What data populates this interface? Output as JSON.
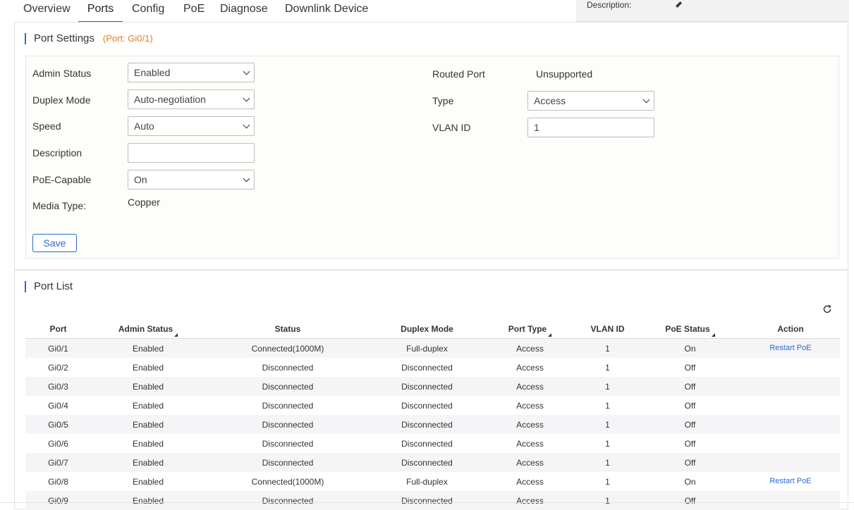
{
  "tabs": [
    {
      "label": "Overview"
    },
    {
      "label": "Ports"
    },
    {
      "label": "Config"
    },
    {
      "label": "PoE"
    },
    {
      "label": "Diagnose"
    },
    {
      "label": "Downlink Device"
    }
  ],
  "description_panel": {
    "label": "Description:",
    "edit_icon": "pencil-icon"
  },
  "port_settings": {
    "title": "Port Settings",
    "port_tag": "(Port: Gi0/1)",
    "admin_status": {
      "label": "Admin Status",
      "value": "Enabled"
    },
    "duplex_mode": {
      "label": "Duplex Mode",
      "value": "Auto-negotiation"
    },
    "speed": {
      "label": "Speed",
      "value": "Auto"
    },
    "description": {
      "label": "Description",
      "value": ""
    },
    "poe_capable": {
      "label": "PoE-Capable",
      "value": "On"
    },
    "media_type": {
      "label": "Media Type:",
      "value": "Copper"
    },
    "routed_port": {
      "label": "Routed Port",
      "value": "Unsupported"
    },
    "type": {
      "label": "Type",
      "value": "Access"
    },
    "vlan_id": {
      "label": "VLAN ID",
      "value": "1"
    },
    "save_label": "Save"
  },
  "port_list": {
    "title": "Port List",
    "refresh_icon": "refresh-icon",
    "columns": [
      "Port",
      "Admin Status",
      "Status",
      "Duplex Mode",
      "Port Type",
      "VLAN ID",
      "PoE Status",
      "Action"
    ],
    "rows": [
      {
        "port": "Gi0/1",
        "admin": "Enabled",
        "status": "Connected(1000M)",
        "duplex": "Full-duplex",
        "type": "Access",
        "vlan": "1",
        "poe": "On",
        "action": "Restart PoE"
      },
      {
        "port": "Gi0/2",
        "admin": "Enabled",
        "status": "Disconnected",
        "duplex": "Disconnected",
        "type": "Access",
        "vlan": "1",
        "poe": "Off",
        "action": ""
      },
      {
        "port": "Gi0/3",
        "admin": "Enabled",
        "status": "Disconnected",
        "duplex": "Disconnected",
        "type": "Access",
        "vlan": "1",
        "poe": "Off",
        "action": ""
      },
      {
        "port": "Gi0/4",
        "admin": "Enabled",
        "status": "Disconnected",
        "duplex": "Disconnected",
        "type": "Access",
        "vlan": "1",
        "poe": "Off",
        "action": ""
      },
      {
        "port": "Gi0/5",
        "admin": "Enabled",
        "status": "Disconnected",
        "duplex": "Disconnected",
        "type": "Access",
        "vlan": "1",
        "poe": "Off",
        "action": ""
      },
      {
        "port": "Gi0/6",
        "admin": "Enabled",
        "status": "Disconnected",
        "duplex": "Disconnected",
        "type": "Access",
        "vlan": "1",
        "poe": "Off",
        "action": ""
      },
      {
        "port": "Gi0/7",
        "admin": "Enabled",
        "status": "Disconnected",
        "duplex": "Disconnected",
        "type": "Access",
        "vlan": "1",
        "poe": "Off",
        "action": ""
      },
      {
        "port": "Gi0/8",
        "admin": "Enabled",
        "status": "Connected(1000M)",
        "duplex": "Full-duplex",
        "type": "Access",
        "vlan": "1",
        "poe": "On",
        "action": "Restart PoE"
      },
      {
        "port": "Gi0/9",
        "admin": "Enabled",
        "status": "Disconnected",
        "duplex": "Disconnected",
        "type": "Access",
        "vlan": "1",
        "poe": "Off",
        "action": ""
      }
    ]
  },
  "colors": {
    "accent": "#2a6ad4",
    "port_tag": "#e57c1a"
  }
}
